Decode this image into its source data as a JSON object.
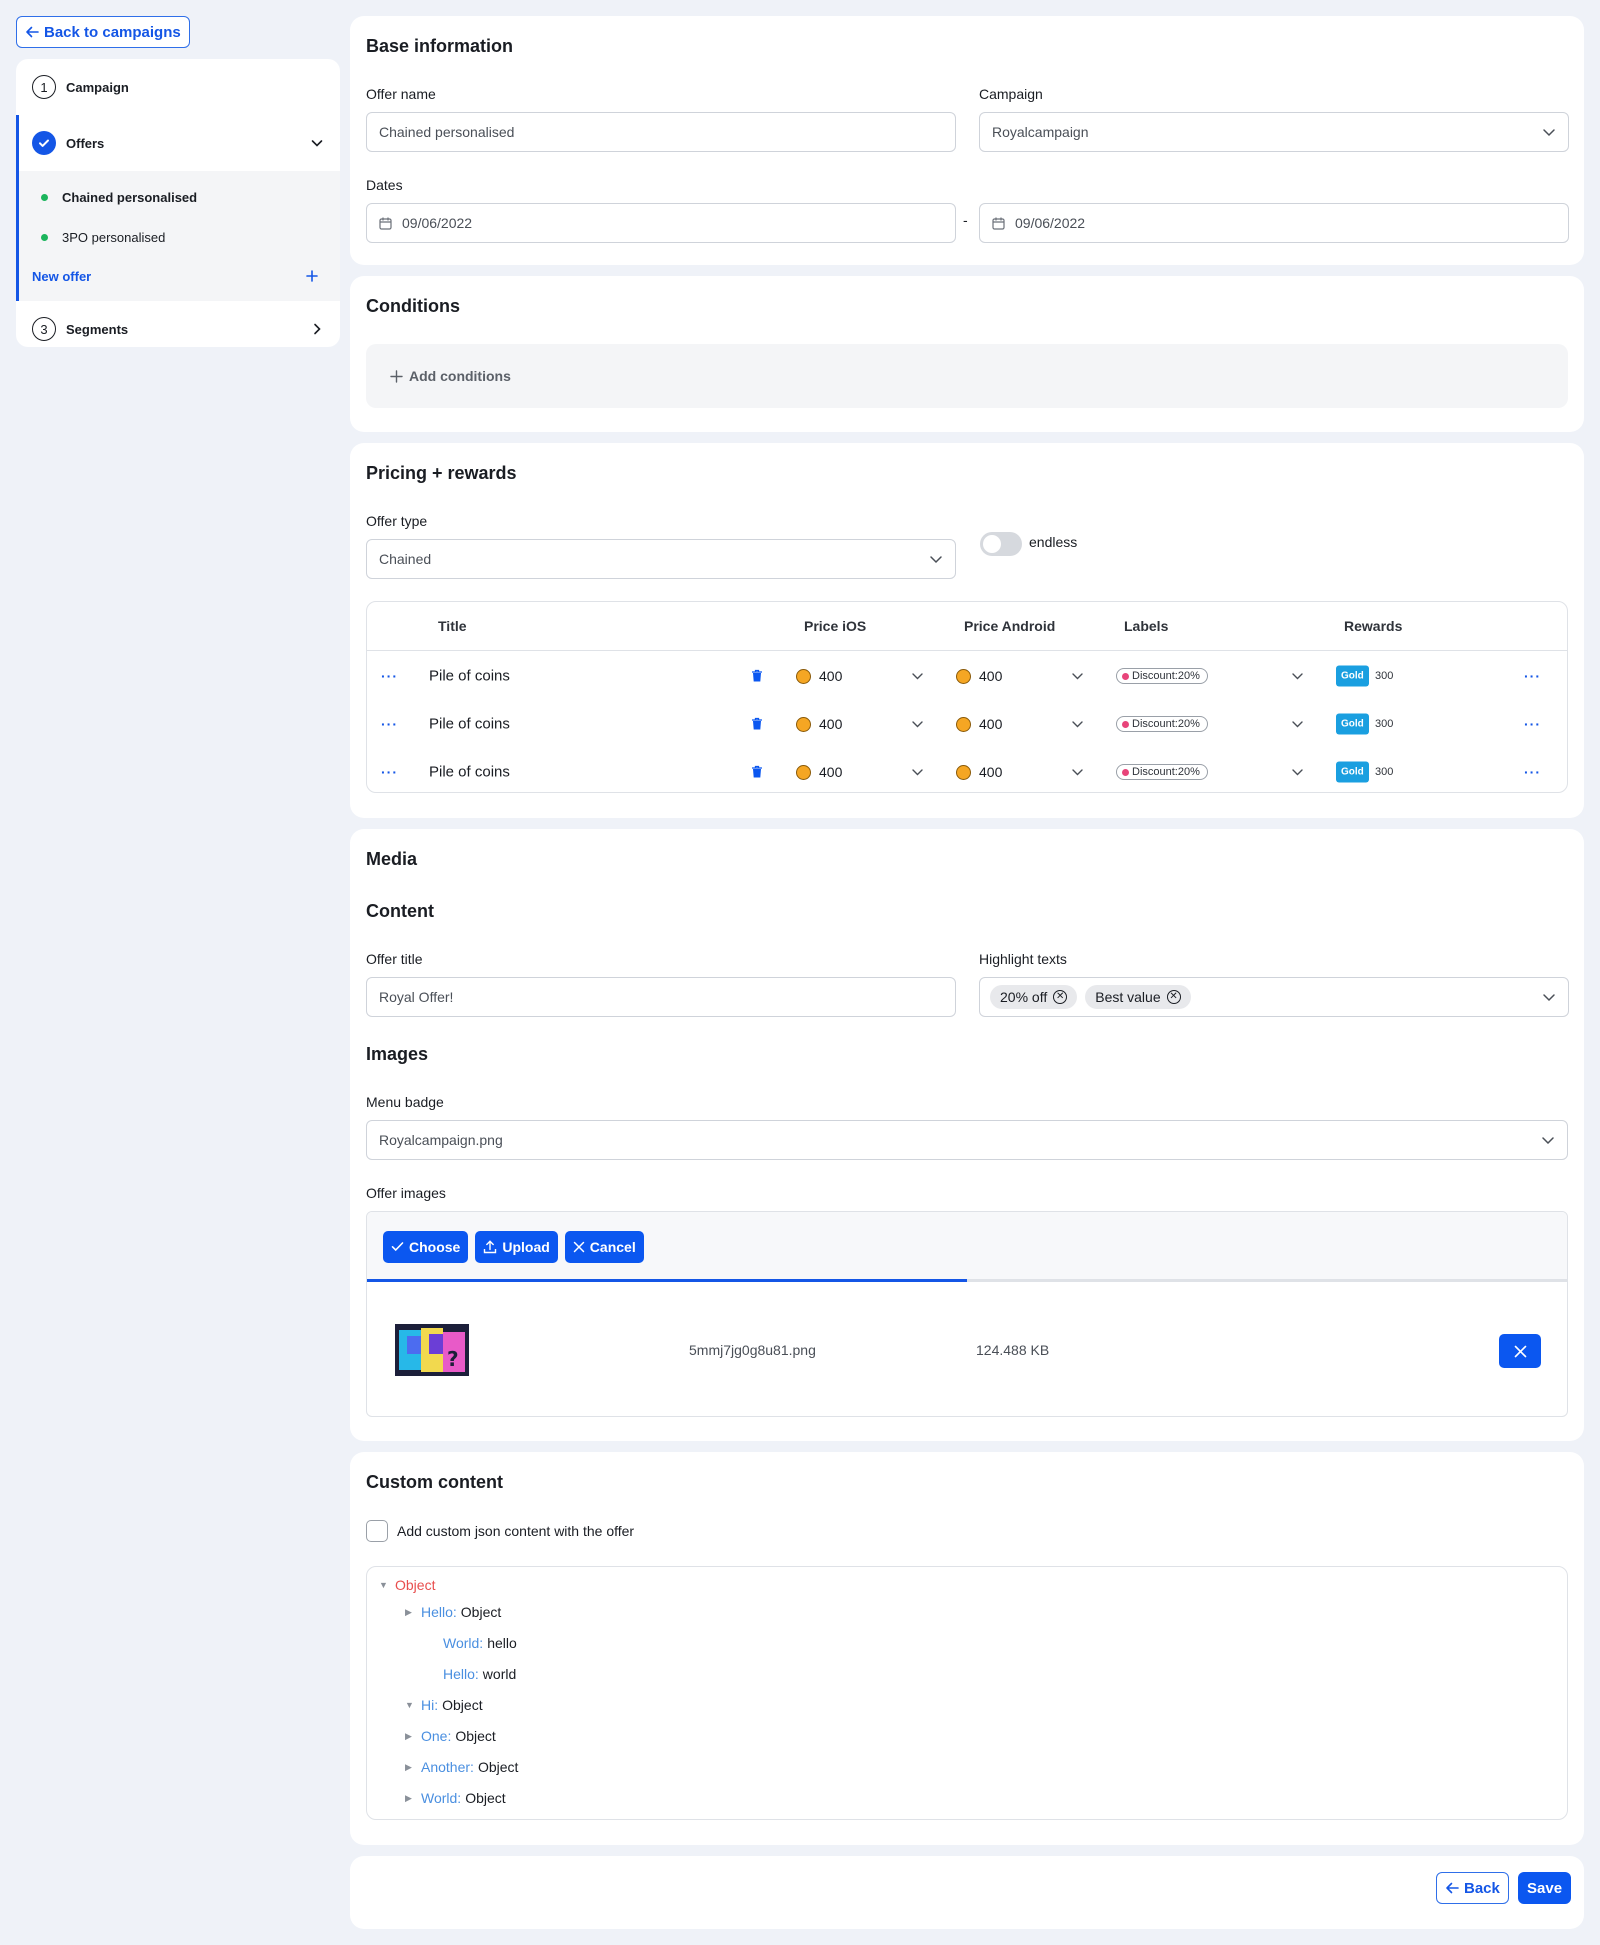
{
  "nav": {
    "back_label": "Back to campaigns",
    "steps": [
      {
        "num": "1",
        "label": "Campaign"
      },
      {
        "label": "Offers"
      },
      {
        "num": "3",
        "label": "Segments"
      }
    ],
    "offers": [
      {
        "label": "Chained personalised"
      },
      {
        "label": "3PO personalised"
      }
    ],
    "new_offer_label": "New offer"
  },
  "base": {
    "title": "Base information",
    "offer_name_label": "Offer name",
    "offer_name_value": "Chained personalised",
    "campaign_label": "Campaign",
    "campaign_value": "Royalcampaign",
    "dates_label": "Dates",
    "date_from": "09/06/2022",
    "date_separator": "-",
    "date_to": "09/06/2022"
  },
  "conditions": {
    "title": "Conditions",
    "add_label": "Add conditions"
  },
  "pricing": {
    "title": "Pricing + rewards",
    "offer_type_label": "Offer type",
    "offer_type_value": "Chained",
    "endless_label": "endless",
    "endless_on": false,
    "columns": [
      "Title",
      "Price iOS",
      "Price Android",
      "Labels",
      "Rewards"
    ],
    "rows": [
      {
        "menu": "···",
        "title": "Pile of coins",
        "price_ios": "400",
        "price_android": "400",
        "label": "Discount:20%",
        "reward_tag": "Gold",
        "reward_amount": "300",
        "row_menu": "···"
      },
      {
        "menu": "···",
        "title": "Pile of coins",
        "price_ios": "400",
        "price_android": "400",
        "label": "Discount:20%",
        "reward_tag": "Gold",
        "reward_amount": "300",
        "row_menu": "···"
      },
      {
        "menu": "···",
        "title": "Pile of coins",
        "price_ios": "400",
        "price_android": "400",
        "label": "Discount:20%",
        "reward_tag": "Gold",
        "reward_amount": "300",
        "row_menu": "···"
      }
    ]
  },
  "media": {
    "title": "Media",
    "content_title": "Content",
    "offer_title_label": "Offer title",
    "offer_title_value": "Royal Offer!",
    "highlight_label": "Highlight texts",
    "highlights": [
      "20% off",
      "Best value"
    ],
    "images_title": "Images",
    "menu_badge_label": "Menu badge",
    "menu_badge_value": "Royalcampaign.png",
    "offer_images_label": "Offer images",
    "choose_label": "Choose",
    "upload_label": "Upload",
    "cancel_label": "Cancel",
    "upload_progress": 0.5,
    "file_name": "5mmj7jg0g8u81.png",
    "file_size": "124.488 KB"
  },
  "custom": {
    "title": "Custom content",
    "checkbox_label": "Add custom json content with the offer",
    "checked": false,
    "tree": {
      "root": "Object",
      "nodes": [
        {
          "key": "Hello:",
          "value": "Object",
          "expand": "collapsed"
        },
        {
          "key": "World:",
          "value": "hello",
          "expand": "leaf"
        },
        {
          "key": "Hello:",
          "value": "world",
          "expand": "leaf"
        },
        {
          "key": "Hi:",
          "value": "Object",
          "expand": "expanded"
        },
        {
          "key": "One:",
          "value": "Object",
          "expand": "collapsed"
        },
        {
          "key": "Another:",
          "value": "Object",
          "expand": "collapsed"
        },
        {
          "key": "World:",
          "value": "Object",
          "expand": "collapsed"
        }
      ]
    }
  },
  "footer": {
    "back_label": "Back",
    "save_label": "Save"
  },
  "colors": {
    "primary": "#0b57f0",
    "success_dot": "#1bb55c",
    "coin": "#f5a623",
    "reward_tag": "#1a9fe0",
    "json_key": "#4a8fe0",
    "json_root": "#e84e4e"
  },
  "icons": {
    "back": "arrow-left-icon",
    "check": "check-icon",
    "chevron_down": "chevron-down-icon",
    "chevron_right": "chevron-right-icon",
    "plus": "plus-icon",
    "calendar": "calendar-icon",
    "trash": "trash-icon",
    "coin": "coin-icon",
    "tag": "tag-icon",
    "upload": "upload-icon",
    "close": "close-icon",
    "remove_circle": "circle-x-icon"
  }
}
